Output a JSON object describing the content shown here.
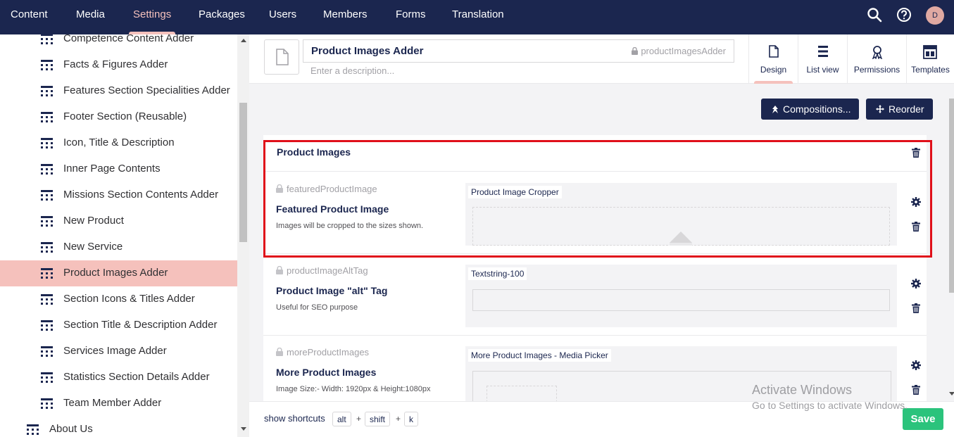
{
  "topnav": {
    "items": [
      "Content",
      "Media",
      "Settings",
      "Packages",
      "Users",
      "Members",
      "Forms",
      "Translation"
    ],
    "active": "Settings",
    "avatar_initial": "D",
    "icons": [
      "search-icon",
      "help-icon"
    ]
  },
  "tree": {
    "items": [
      "Competence Content Adder",
      "Facts & Figures Adder",
      "Features Section Specialities Adder",
      "Footer Section (Reusable)",
      "Icon, Title & Description",
      "Inner Page Contents",
      "Missions Section Contents Adder",
      "New Product",
      "New Service",
      "Product Images Adder",
      "Section Icons & Titles Adder",
      "Section Title & Description Adder",
      "Services Image Adder",
      "Statistics Section Details Adder",
      "Team Member Adder"
    ],
    "selected": "Product Images Adder",
    "parent_item": "About Us"
  },
  "header": {
    "name": "Product Images Adder",
    "alias": "productImagesAdder",
    "description_placeholder": "Enter a description...",
    "apps": [
      "Design",
      "List view",
      "Permissions",
      "Templates"
    ],
    "active_app": "Design"
  },
  "toolbar": {
    "compositions_label": "Compositions...",
    "reorder_label": "Reorder"
  },
  "group": {
    "title": "Product Images",
    "properties": [
      {
        "alias": "featuredProductImage",
        "name": "Featured Product Image",
        "description": "Images will be cropped to the sizes shown.",
        "editor": "Product Image Cropper"
      },
      {
        "alias": "productImageAltTag",
        "name": "Product Image \"alt\" Tag",
        "description": "Useful for SEO purpose",
        "editor": "Textstring-100"
      },
      {
        "alias": "moreProductImages",
        "name": "More Product Images",
        "description": "Image Size:- Width: 1920px & Height:1080px",
        "editor": "More Product Images - Media Picker"
      }
    ]
  },
  "bottombar": {
    "shortcuts_label": "show shortcuts",
    "keys": [
      "alt",
      "shift",
      "k"
    ],
    "save_label": "Save"
  },
  "watermark": {
    "title": "Activate Windows",
    "subtitle": "Go to Settings to activate Windows."
  },
  "colors": {
    "nav_bg": "#1b264f",
    "accent": "#f5c1bc",
    "save": "#2bc37c",
    "highlight_box": "#e0101a"
  }
}
